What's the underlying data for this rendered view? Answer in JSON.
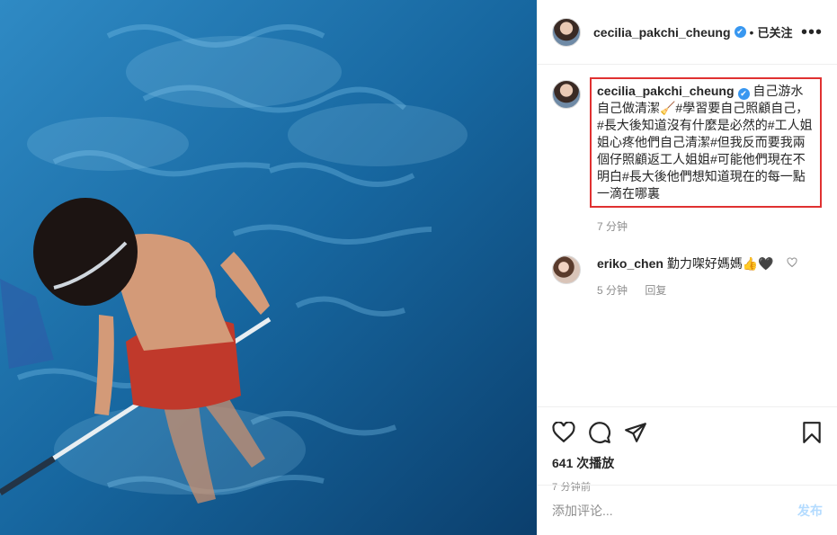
{
  "post": {
    "author": "cecilia_pakchi_cheung",
    "verified_mark": "✔",
    "separator": "•",
    "follow_status": "已关注",
    "more_label": "•••"
  },
  "caption": {
    "username": "cecilia_pakchi_cheung",
    "text": "自己游水自己做清潔🧹#學習要自己照顧自己，#長大後知道沒有什麼是必然的#工人姐姐心疼他們自己清潔#但我反而要我兩個仔照顧返工人姐姐#可能他們現在不明白#長大後他們想知道現在的每一點一滴在哪裏",
    "time": "7 分钟"
  },
  "comments": [
    {
      "username": "eriko_chen",
      "text": "勤力㗎好媽媽👍🖤",
      "time": "5 分钟",
      "reply_label": "回复"
    }
  ],
  "engagement": {
    "views": "641 次播放",
    "posted": "7 分钟前"
  },
  "add_comment": {
    "placeholder": "添加评论...",
    "post_label": "发布"
  },
  "colors": {
    "highlight_border": "#e03131",
    "verified": "#3897f0",
    "muted_text": "#8e8e8e",
    "post_disabled": "#b3dbff"
  }
}
